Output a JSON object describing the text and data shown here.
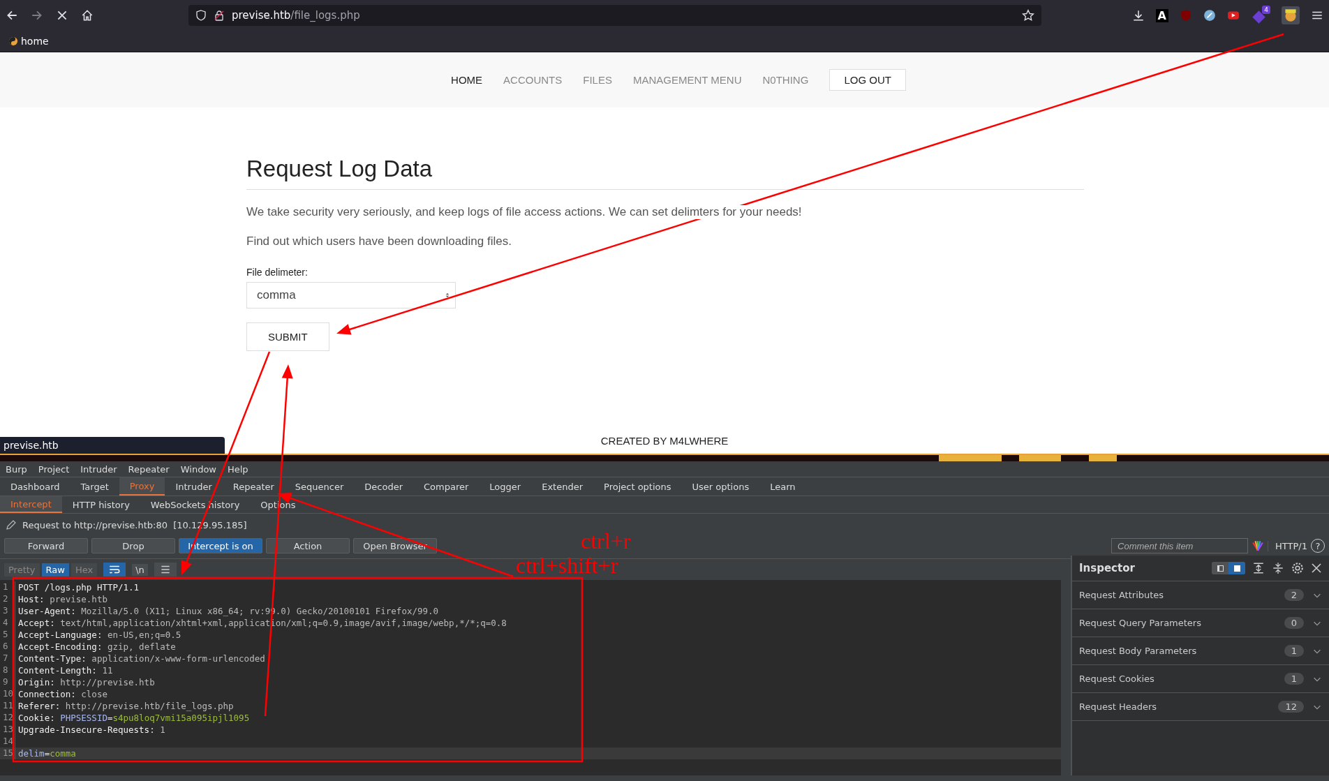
{
  "browser": {
    "url_host": "previse.htb",
    "url_path": "/file_logs.php",
    "bookmarks": [
      {
        "label": "home"
      }
    ],
    "extension_letter": "A",
    "extension_badge": "4"
  },
  "site": {
    "nav": [
      {
        "label": "HOME",
        "kind": "link",
        "selected": true
      },
      {
        "label": "ACCOUNTS",
        "kind": "link",
        "selected": false
      },
      {
        "label": "FILES",
        "kind": "link",
        "selected": false
      },
      {
        "label": "MANAGEMENT MENU",
        "kind": "link",
        "selected": false
      },
      {
        "label": "N0THING",
        "kind": "link",
        "selected": false
      },
      {
        "label": "LOG OUT",
        "kind": "button",
        "selected": false
      }
    ],
    "heading": "Request Log Data",
    "paragraphs": [
      "We take security very seriously, and keep logs of file access actions. We can set delimters for your needs!",
      "Find out which users have been downloading files."
    ],
    "field_label": "File delimeter:",
    "select_value": "comma",
    "submit": "SUBMIT",
    "footer": "CREATED BY M4LWHERE"
  },
  "status_tooltip": "previse.htb",
  "burp": {
    "menu": [
      "Burp",
      "Project",
      "Intruder",
      "Repeater",
      "Window",
      "Help"
    ],
    "tabs": [
      {
        "label": "Dashboard",
        "selected": false
      },
      {
        "label": "Target",
        "selected": false
      },
      {
        "label": "Proxy",
        "selected": true
      },
      {
        "label": "Intruder",
        "selected": false
      },
      {
        "label": "Repeater",
        "selected": false
      },
      {
        "label": "Sequencer",
        "selected": false
      },
      {
        "label": "Decoder",
        "selected": false
      },
      {
        "label": "Comparer",
        "selected": false
      },
      {
        "label": "Logger",
        "selected": false
      },
      {
        "label": "Extender",
        "selected": false
      },
      {
        "label": "Project options",
        "selected": false
      },
      {
        "label": "User options",
        "selected": false
      },
      {
        "label": "Learn",
        "selected": false
      }
    ],
    "subtabs": [
      {
        "label": "Intercept",
        "selected": true
      },
      {
        "label": "HTTP history",
        "selected": false
      },
      {
        "label": "WebSockets history",
        "selected": false
      },
      {
        "label": "Options",
        "selected": false
      }
    ],
    "request_info": "Request to http://previse.htb:80  [10.129.95.185]",
    "buttons": [
      {
        "label": "Forward",
        "on": false
      },
      {
        "label": "Drop",
        "on": false
      },
      {
        "label": "Intercept is on",
        "on": true
      },
      {
        "label": "Action",
        "on": false
      },
      {
        "label": "Open Browser",
        "on": false
      }
    ],
    "comment_placeholder": "Comment this item",
    "protocol": "HTTP/1",
    "help": "?",
    "views": [
      {
        "label": "Pretty",
        "selected": false
      },
      {
        "label": "Raw",
        "selected": true
      },
      {
        "label": "Hex",
        "selected": false
      }
    ],
    "newline_toggle": "\\n",
    "lines": [
      {
        "number": "1",
        "highlighted": false,
        "segments": [
          {
            "text": "POST /logs.php HTTP/1.1",
            "kind": "plain"
          }
        ]
      },
      {
        "number": "2",
        "highlighted": false,
        "segments": [
          {
            "text": "Host:",
            "kind": "header_name"
          },
          {
            "text": " previse.htb",
            "kind": "header_value"
          }
        ]
      },
      {
        "number": "3",
        "highlighted": false,
        "segments": [
          {
            "text": "User-Agent:",
            "kind": "header_name"
          },
          {
            "text": " Mozilla/5.0 (X11; Linux x86_64; rv:99.0) Gecko/20100101 Firefox/99.0",
            "kind": "header_value"
          }
        ]
      },
      {
        "number": "4",
        "highlighted": false,
        "segments": [
          {
            "text": "Accept:",
            "kind": "header_name"
          },
          {
            "text": " text/html,application/xhtml+xml,application/xml;q=0.9,image/avif,image/webp,*/*;q=0.8",
            "kind": "header_value"
          }
        ]
      },
      {
        "number": "5",
        "highlighted": false,
        "segments": [
          {
            "text": "Accept-Language:",
            "kind": "header_name"
          },
          {
            "text": " en-US,en;q=0.5",
            "kind": "header_value"
          }
        ]
      },
      {
        "number": "6",
        "highlighted": false,
        "segments": [
          {
            "text": "Accept-Encoding:",
            "kind": "header_name"
          },
          {
            "text": " gzip, deflate",
            "kind": "header_value"
          }
        ]
      },
      {
        "number": "7",
        "highlighted": false,
        "segments": [
          {
            "text": "Content-Type:",
            "kind": "header_name"
          },
          {
            "text": " application/x-www-form-urlencoded",
            "kind": "header_value"
          }
        ]
      },
      {
        "number": "8",
        "highlighted": false,
        "segments": [
          {
            "text": "Content-Length:",
            "kind": "header_name"
          },
          {
            "text": " 11",
            "kind": "header_value"
          }
        ]
      },
      {
        "number": "9",
        "highlighted": false,
        "segments": [
          {
            "text": "Origin:",
            "kind": "header_name"
          },
          {
            "text": " http://previse.htb",
            "kind": "header_value"
          }
        ]
      },
      {
        "number": "10",
        "highlighted": false,
        "segments": [
          {
            "text": "Connection:",
            "kind": "header_name"
          },
          {
            "text": " close",
            "kind": "header_value"
          }
        ]
      },
      {
        "number": "11",
        "highlighted": false,
        "segments": [
          {
            "text": "Referer:",
            "kind": "header_name"
          },
          {
            "text": " http://previse.htb/file_logs.php",
            "kind": "header_value"
          }
        ]
      },
      {
        "number": "12",
        "highlighted": false,
        "segments": [
          {
            "text": "Cookie:",
            "kind": "header_name"
          },
          {
            "text": " PHPSESSID",
            "kind": "param_name"
          },
          {
            "text": "=",
            "kind": "plain"
          },
          {
            "text": "s4pu8loq7vmi15a095ipjl1095",
            "kind": "param_value"
          }
        ]
      },
      {
        "number": "13",
        "highlighted": false,
        "segments": [
          {
            "text": "Upgrade-Insecure-Requests:",
            "kind": "header_name"
          },
          {
            "text": " 1",
            "kind": "header_value"
          }
        ]
      },
      {
        "number": "14",
        "highlighted": false
      },
      {
        "number": "15",
        "highlighted": true,
        "segments": [
          {
            "text": "delim",
            "kind": "param_name"
          },
          {
            "text": "=",
            "kind": "plain"
          },
          {
            "text": "comma",
            "kind": "param_value"
          }
        ]
      }
    ],
    "inspector": {
      "title": "Inspector",
      "layouts": [
        {
          "selected": false
        },
        {
          "selected": true
        }
      ],
      "sections": [
        {
          "label": "Request Attributes",
          "count": "2"
        },
        {
          "label": "Request Query Parameters",
          "count": "0"
        },
        {
          "label": "Request Body Parameters",
          "count": "1"
        },
        {
          "label": "Request Cookies",
          "count": "1"
        },
        {
          "label": "Request Headers",
          "count": "12"
        }
      ]
    }
  },
  "annotations": [
    "ctrl+r",
    "ctrl+shift+r"
  ]
}
